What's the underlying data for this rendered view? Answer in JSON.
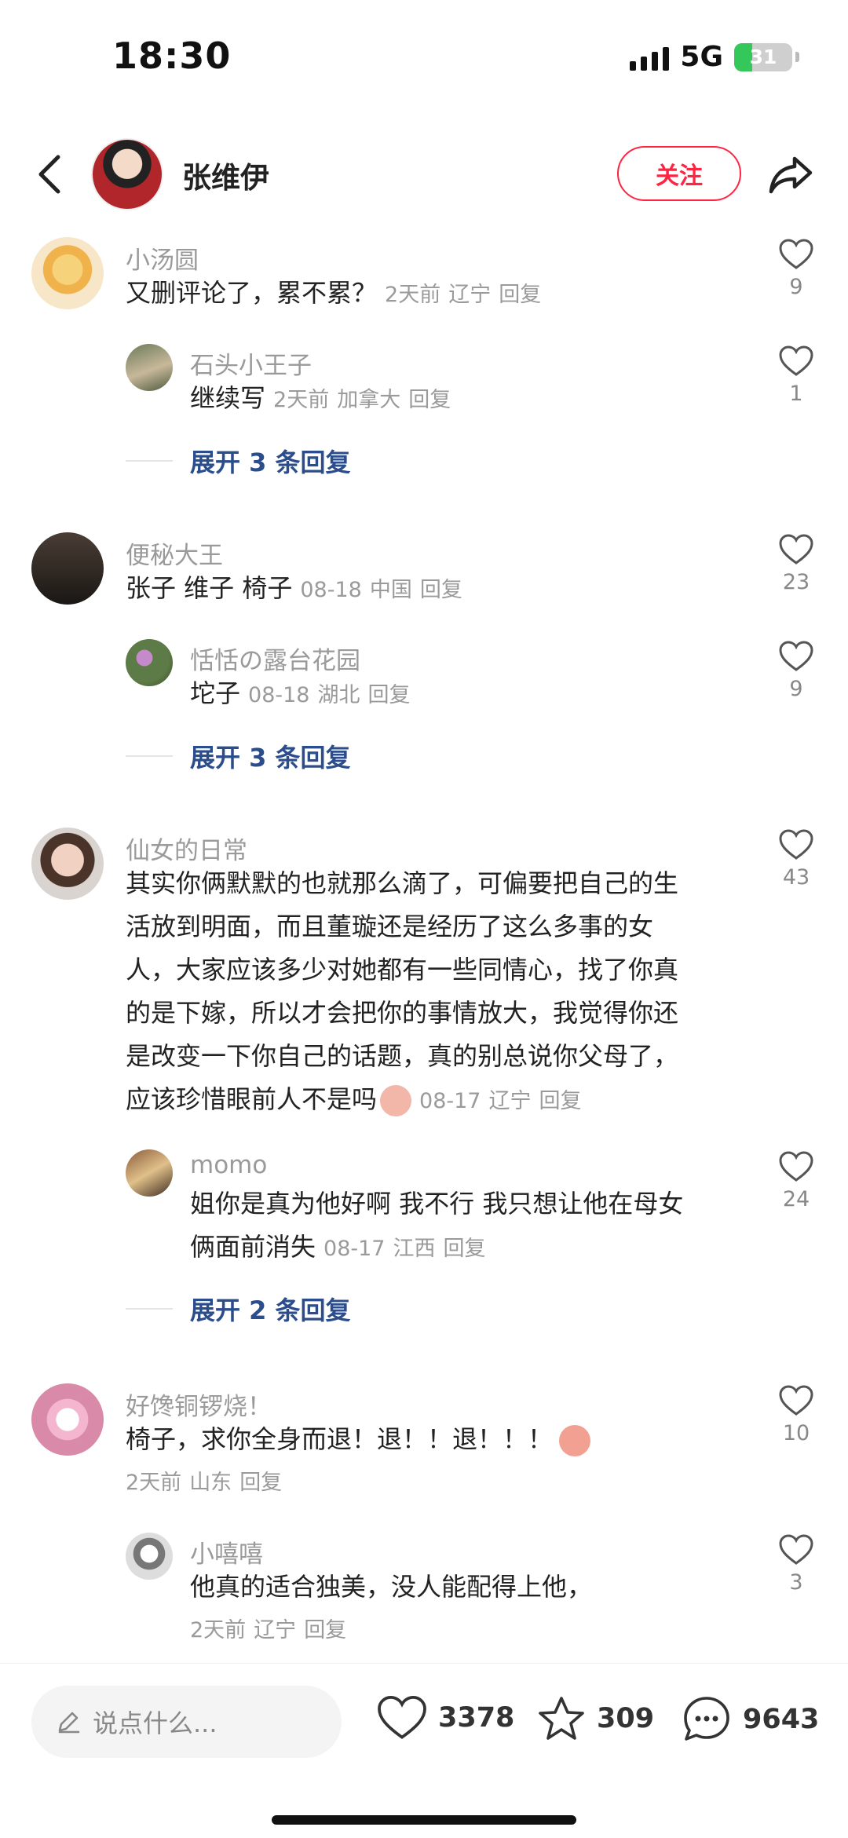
{
  "status_bar": {
    "time": "18:30",
    "network": "5G",
    "battery": "31"
  },
  "header": {
    "username": "张维伊",
    "follow_label": "关注"
  },
  "comments": [
    {
      "user": "小汤圆",
      "text": "又删评论了，累不累？",
      "time": "2天前",
      "location": "辽宁",
      "reply_label": "回复",
      "likes": "9",
      "replies": [
        {
          "user": "石头小王子",
          "text": "继续写",
          "time": "2天前",
          "location": "加拿大",
          "reply_label": "回复",
          "likes": "1"
        }
      ],
      "expand_label": "展开 3 条回复"
    },
    {
      "user": "便秘大王",
      "text": "张子  维子  椅子",
      "time": "08-18",
      "location": "中国",
      "reply_label": "回复",
      "likes": "23",
      "replies": [
        {
          "user": "恬恬の露台花园",
          "text": "坨子",
          "time": "08-18",
          "location": "湖北",
          "reply_label": "回复",
          "likes": "9"
        }
      ],
      "expand_label": "展开 3 条回复"
    },
    {
      "user": "仙女的日常",
      "text_lines": [
        "其实你俩默默的也就那么滴了，可偏要把自己的生",
        "活放到明面，而且董璇还是经历了这么多事的女",
        "人，大家应该多少对她都有一些同情心，找了你真",
        "的是下嫁，所以才会把你的事情放大，我觉得你还",
        "是改变一下你自己的话题，真的别总说你父母了，",
        "应该珍惜眼前人不是吗"
      ],
      "time": "08-17",
      "location": "辽宁",
      "reply_label": "回复",
      "likes": "43",
      "replies": [
        {
          "user": "momo",
          "text_lines": [
            "姐你是真为他好啊 我不行 我只想让他在母女",
            "俩面前消失"
          ],
          "time": "08-17",
          "location": "江西",
          "reply_label": "回复",
          "likes": "24"
        }
      ],
      "expand_label": "展开 2 条回复"
    },
    {
      "user": "好馋铜锣烧！",
      "text": "椅子，求你全身而退！退！！退！！！",
      "time": "2天前",
      "location": "山东",
      "reply_label": "回复",
      "likes": "10",
      "replies": [
        {
          "user": "小嘻嘻",
          "text": "他真的适合独美，没人能配得上他，",
          "time": "2天前",
          "location": "辽宁",
          "reply_label": "回复",
          "likes": "3"
        }
      ]
    }
  ],
  "bottom_bar": {
    "input_placeholder": "说点什么...",
    "likes": "3378",
    "favorites": "309",
    "comments": "9643"
  },
  "icons": {
    "like": "heart-icon",
    "favorite": "star-icon",
    "comment": "chat-bubble-icon",
    "share": "share-arrow-icon",
    "back": "back-chevron-icon",
    "edit": "pencil-icon"
  },
  "colors": {
    "accent": "#ff2442",
    "link": "#2b4d8c",
    "meta": "#9a9a9a"
  }
}
